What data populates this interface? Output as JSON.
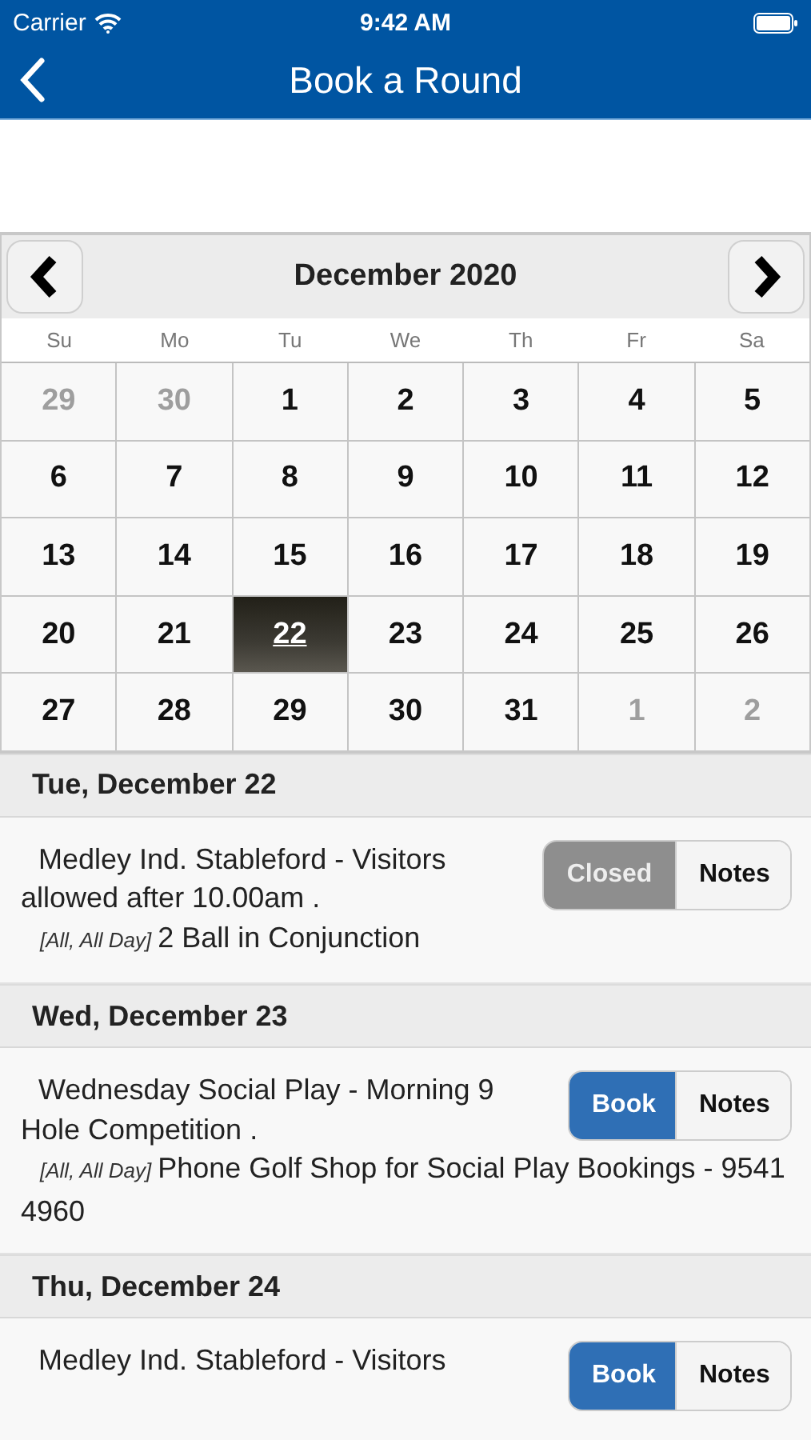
{
  "status_bar": {
    "carrier": "Carrier",
    "time": "9:42 AM"
  },
  "nav": {
    "title": "Book a Round"
  },
  "calendar": {
    "month": "December 2020",
    "weekdays": [
      "Su",
      "Mo",
      "Tu",
      "We",
      "Th",
      "Fr",
      "Sa"
    ],
    "days": [
      {
        "label": "29",
        "other_month": true,
        "selected": false
      },
      {
        "label": "30",
        "other_month": true,
        "selected": false
      },
      {
        "label": "1",
        "other_month": false,
        "selected": false
      },
      {
        "label": "2",
        "other_month": false,
        "selected": false
      },
      {
        "label": "3",
        "other_month": false,
        "selected": false
      },
      {
        "label": "4",
        "other_month": false,
        "selected": false
      },
      {
        "label": "5",
        "other_month": false,
        "selected": false
      },
      {
        "label": "6",
        "other_month": false,
        "selected": false
      },
      {
        "label": "7",
        "other_month": false,
        "selected": false
      },
      {
        "label": "8",
        "other_month": false,
        "selected": false
      },
      {
        "label": "9",
        "other_month": false,
        "selected": false
      },
      {
        "label": "10",
        "other_month": false,
        "selected": false
      },
      {
        "label": "11",
        "other_month": false,
        "selected": false
      },
      {
        "label": "12",
        "other_month": false,
        "selected": false
      },
      {
        "label": "13",
        "other_month": false,
        "selected": false
      },
      {
        "label": "14",
        "other_month": false,
        "selected": false
      },
      {
        "label": "15",
        "other_month": false,
        "selected": false
      },
      {
        "label": "16",
        "other_month": false,
        "selected": false
      },
      {
        "label": "17",
        "other_month": false,
        "selected": false
      },
      {
        "label": "18",
        "other_month": false,
        "selected": false
      },
      {
        "label": "19",
        "other_month": false,
        "selected": false
      },
      {
        "label": "20",
        "other_month": false,
        "selected": false
      },
      {
        "label": "21",
        "other_month": false,
        "selected": false
      },
      {
        "label": "22",
        "other_month": false,
        "selected": true
      },
      {
        "label": "23",
        "other_month": false,
        "selected": false
      },
      {
        "label": "24",
        "other_month": false,
        "selected": false
      },
      {
        "label": "25",
        "other_month": false,
        "selected": false
      },
      {
        "label": "26",
        "other_month": false,
        "selected": false
      },
      {
        "label": "27",
        "other_month": false,
        "selected": false
      },
      {
        "label": "28",
        "other_month": false,
        "selected": false
      },
      {
        "label": "29",
        "other_month": false,
        "selected": false
      },
      {
        "label": "30",
        "other_month": false,
        "selected": false
      },
      {
        "label": "31",
        "other_month": false,
        "selected": false
      },
      {
        "label": "1",
        "other_month": true,
        "selected": false
      },
      {
        "label": "2",
        "other_month": true,
        "selected": false
      }
    ]
  },
  "schedule": [
    {
      "date": "Tue, December 22",
      "events": [
        {
          "title": "Medley Ind. Stableford - Visitors allowed after 10.00am .",
          "tag": "[All, All Day]",
          "note": "2 Ball in Conjunction",
          "action": {
            "kind": "closed",
            "label": "Closed"
          },
          "notes_button": "Notes"
        }
      ]
    },
    {
      "date": "Wed, December 23",
      "events": [
        {
          "title": "Wednesday Social Play - Morning 9 Hole Competition .",
          "tag": "[All, All Day]",
          "note": "Phone Golf Shop for Social Play Bookings - 9541 4960",
          "action": {
            "kind": "book",
            "label": "Book"
          },
          "notes_button": "Notes"
        }
      ]
    },
    {
      "date": "Thu, December 24",
      "events": [
        {
          "title": "Medley Ind. Stableford - Visitors",
          "action": {
            "kind": "book",
            "label": "Book"
          },
          "notes_button": "Notes"
        }
      ]
    }
  ]
}
